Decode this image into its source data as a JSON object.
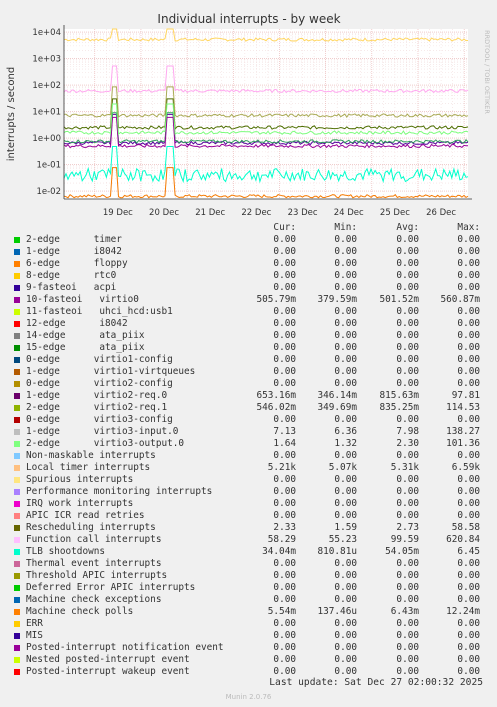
{
  "chart_data": {
    "type": "line",
    "title": "Individual interrupts - by week",
    "ylabel": "interrupts / second",
    "yscale": "log",
    "ylim": [
      0.005,
      13000
    ],
    "yticks": [
      "1e-02",
      "1e-01",
      "1e+00",
      "1e+01",
      "1e+02",
      "1e+03",
      "1e+04"
    ],
    "xticks": [
      "19 Dec",
      "20 Dec",
      "21 Dec",
      "22 Dec",
      "23 Dec",
      "24 Dec",
      "25 Dec",
      "26 Dec"
    ],
    "xrange": [
      "2025-12-18 08:00",
      "2025-12-27 02:00"
    ],
    "watermark": "RRDTOOL / TOBI OETIKER",
    "grid": true,
    "series": [
      {
        "name": "Local timer interrupts",
        "color": "#FFD660",
        "approx": 5210
      },
      {
        "name": "Machine check polls",
        "color": "#F57900",
        "approx": 0.0064
      },
      {
        "name": "Rescheduling interrupts",
        "color": "#4E6E00",
        "approx": 2.5
      },
      {
        "name": "Function call interrupts",
        "color": "#FFA8F0",
        "approx": 60,
        "spikes": 520
      },
      {
        "name": "virtio2-req.0",
        "color": "#55009D",
        "approx": 0.65
      },
      {
        "name": "virtio2-req.1",
        "color": "#2E9C5A",
        "approx": 0.75
      },
      {
        "name": "virtio0",
        "color": "#990099",
        "approx": 0.5
      },
      {
        "name": "virtio3-input.0",
        "color": "#AAAA55",
        "approx": 7.1
      },
      {
        "name": "virtio3-output.0",
        "color": "#7CFC7C",
        "approx": 1.6
      },
      {
        "name": "TLB shootdowns",
        "color": "#00FFCC",
        "approx": 0.04
      }
    ]
  },
  "legend": {
    "headers": {
      "cur": "Cur:",
      "min": "Min:",
      "avg": "Avg:",
      "max": "Max:"
    },
    "rows": [
      {
        "name": "2-edge      timer",
        "color": "#00CC00",
        "cur": "0.00",
        "min": "0.00",
        "avg": "0.00",
        "max": "0.00"
      },
      {
        "name": "1-edge      i8042",
        "color": "#0066B3",
        "cur": "0.00",
        "min": "0.00",
        "avg": "0.00",
        "max": "0.00"
      },
      {
        "name": "6-edge      floppy",
        "color": "#FF8000",
        "cur": "0.00",
        "min": "0.00",
        "avg": "0.00",
        "max": "0.00"
      },
      {
        "name": "8-edge      rtc0",
        "color": "#FFCC00",
        "cur": "0.00",
        "min": "0.00",
        "avg": "0.00",
        "max": "0.00"
      },
      {
        "name": "9-fasteoi   acpi",
        "color": "#330099",
        "cur": "0.00",
        "min": "0.00",
        "avg": "0.00",
        "max": "0.00"
      },
      {
        "name": "10-fasteoi   virtio0",
        "color": "#990099",
        "cur": "505.79m",
        "min": "379.59m",
        "avg": "501.52m",
        "max": "560.87m"
      },
      {
        "name": "11-fasteoi   uhci_hcd:usb1",
        "color": "#CCFF00",
        "cur": "0.00",
        "min": "0.00",
        "avg": "0.00",
        "max": "0.00"
      },
      {
        "name": "12-edge      i8042",
        "color": "#FF0000",
        "cur": "0.00",
        "min": "0.00",
        "avg": "0.00",
        "max": "0.00"
      },
      {
        "name": "14-edge      ata_piix",
        "color": "#808080",
        "cur": "0.00",
        "min": "0.00",
        "avg": "0.00",
        "max": "0.00"
      },
      {
        "name": "15-edge      ata_piix",
        "color": "#008F00",
        "cur": "0.00",
        "min": "0.00",
        "avg": "0.00",
        "max": "0.00"
      },
      {
        "name": "0-edge      virtio1-config",
        "color": "#00487D",
        "cur": "0.00",
        "min": "0.00",
        "avg": "0.00",
        "max": "0.00"
      },
      {
        "name": "1-edge      virtio1-virtqueues",
        "color": "#B35A00",
        "cur": "0.00",
        "min": "0.00",
        "avg": "0.00",
        "max": "0.00"
      },
      {
        "name": "0-edge      virtio2-config",
        "color": "#B38F00",
        "cur": "0.00",
        "min": "0.00",
        "avg": "0.00",
        "max": "0.00"
      },
      {
        "name": "1-edge      virtio2-req.0",
        "color": "#6B006B",
        "cur": "653.16m",
        "min": "346.14m",
        "avg": "815.63m",
        "max": "97.81"
      },
      {
        "name": "2-edge      virtio2-req.1",
        "color": "#8FB300",
        "cur": "546.02m",
        "min": "349.69m",
        "avg": "835.25m",
        "max": "114.53"
      },
      {
        "name": "0-edge      virtio3-config",
        "color": "#B30000",
        "cur": "0.00",
        "min": "0.00",
        "avg": "0.00",
        "max": "0.00"
      },
      {
        "name": "1-edge      virtio3-input.0",
        "color": "#BEBEBE",
        "cur": "7.13",
        "min": "6.36",
        "avg": "7.98",
        "max": "138.27"
      },
      {
        "name": "2-edge      virtio3-output.0",
        "color": "#80FF80",
        "cur": "1.64",
        "min": "1.32",
        "avg": "2.30",
        "max": "101.36"
      },
      {
        "name": "Non-maskable interrupts",
        "color": "#80C9FF",
        "cur": "0.00",
        "min": "0.00",
        "avg": "0.00",
        "max": "0.00"
      },
      {
        "name": "Local timer interrupts",
        "color": "#FFC080",
        "cur": "5.21k",
        "min": "5.07k",
        "avg": "5.31k",
        "max": "6.59k"
      },
      {
        "name": "Spurious interrupts",
        "color": "#FFE680",
        "cur": "0.00",
        "min": "0.00",
        "avg": "0.00",
        "max": "0.00"
      },
      {
        "name": "Performance monitoring interrupts",
        "color": "#AA80FF",
        "cur": "0.00",
        "min": "0.00",
        "avg": "0.00",
        "max": "0.00"
      },
      {
        "name": "IRQ work interrupts",
        "color": "#EE00CC",
        "cur": "0.00",
        "min": "0.00",
        "avg": "0.00",
        "max": "0.00"
      },
      {
        "name": "APIC ICR read retries",
        "color": "#FF8080",
        "cur": "0.00",
        "min": "0.00",
        "avg": "0.00",
        "max": "0.00"
      },
      {
        "name": "Rescheduling interrupts",
        "color": "#666600",
        "cur": "2.33",
        "min": "1.59",
        "avg": "2.73",
        "max": "58.58"
      },
      {
        "name": "Function call interrupts",
        "color": "#FFBFFF",
        "cur": "58.29",
        "min": "55.23",
        "avg": "99.59",
        "max": "620.84"
      },
      {
        "name": "TLB shootdowns",
        "color": "#00FFCC",
        "cur": "34.04m",
        "min": "810.81u",
        "avg": "54.05m",
        "max": "6.45"
      },
      {
        "name": "Thermal event interrupts",
        "color": "#CC6699",
        "cur": "0.00",
        "min": "0.00",
        "avg": "0.00",
        "max": "0.00"
      },
      {
        "name": "Threshold APIC interrupts",
        "color": "#999900",
        "cur": "0.00",
        "min": "0.00",
        "avg": "0.00",
        "max": "0.00"
      },
      {
        "name": "Deferred Error APIC interrupts",
        "color": "#00CC00",
        "cur": "0.00",
        "min": "0.00",
        "avg": "0.00",
        "max": "0.00"
      },
      {
        "name": "Machine check exceptions",
        "color": "#0066B3",
        "cur": "0.00",
        "min": "0.00",
        "avg": "0.00",
        "max": "0.00"
      },
      {
        "name": "Machine check polls",
        "color": "#FF8000",
        "cur": "5.54m",
        "min": "137.46u",
        "avg": "6.43m",
        "max": "12.24m"
      },
      {
        "name": "ERR",
        "color": "#FFCC00",
        "cur": "0.00",
        "min": "0.00",
        "avg": "0.00",
        "max": "0.00"
      },
      {
        "name": "MIS",
        "color": "#330099",
        "cur": "0.00",
        "min": "0.00",
        "avg": "0.00",
        "max": "0.00"
      },
      {
        "name": "Posted-interrupt notification event",
        "color": "#990099",
        "cur": "0.00",
        "min": "0.00",
        "avg": "0.00",
        "max": "0.00"
      },
      {
        "name": "Nested posted-interrupt event",
        "color": "#CCFF00",
        "cur": "0.00",
        "min": "0.00",
        "avg": "0.00",
        "max": "0.00"
      },
      {
        "name": "Posted-interrupt wakeup event",
        "color": "#FF0000",
        "cur": "0.00",
        "min": "0.00",
        "avg": "0.00",
        "max": "0.00"
      }
    ]
  },
  "footer": {
    "last_update": "Last update: Sat Dec 27 02:00:32 2025",
    "generator": "Munin 2.0.76"
  }
}
